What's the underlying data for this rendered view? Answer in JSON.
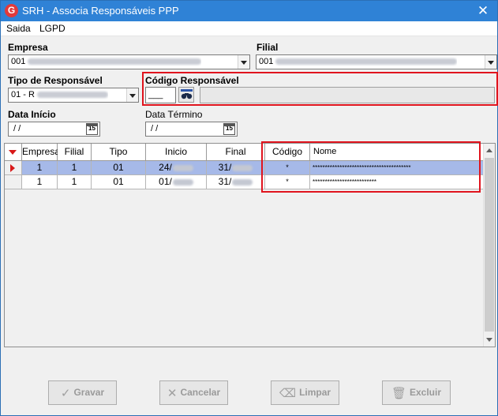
{
  "window": {
    "title": "SRH - Associa Responsáveis PPP",
    "app_icon_letter": "G"
  },
  "menu": [
    {
      "label": "Saida"
    },
    {
      "label": "LGPD"
    }
  ],
  "form": {
    "empresa": {
      "label": "Empresa",
      "value": "001"
    },
    "filial": {
      "label": "Filial",
      "value": "001"
    },
    "tipo_responsavel": {
      "label": "Tipo de Responsável",
      "value": "01 - R"
    },
    "codigo_responsavel": {
      "label": "Código Responsável",
      "value": "___",
      "description": ""
    },
    "data_inicio": {
      "label": "Data Início",
      "value": " / /"
    },
    "data_termino": {
      "label": "Data Término",
      "value": " / /"
    },
    "calendar_icon_text": "15"
  },
  "grid": {
    "columns": [
      "Empresa",
      "Filial",
      "Tipo",
      "Inicio",
      "Final",
      "Código",
      "Nome"
    ],
    "rows": [
      {
        "empresa": "1",
        "filial": "1",
        "tipo": "01",
        "inicio": "24/",
        "final": "31/",
        "codigo": "*",
        "nome": "****************************************",
        "selected": true
      },
      {
        "empresa": "1",
        "filial": "1",
        "tipo": "01",
        "inicio": "01/",
        "final": "31/",
        "codigo": "*",
        "nome": "**************************",
        "selected": false
      }
    ]
  },
  "buttons": {
    "gravar": "Gravar",
    "cancelar": "Cancelar",
    "limpar": "Limpar",
    "excluir": "Excluir"
  },
  "colors": {
    "titlebar": "#2f82d6",
    "highlight_box": "#e0141e",
    "selected_row": "#a6b9e8"
  }
}
